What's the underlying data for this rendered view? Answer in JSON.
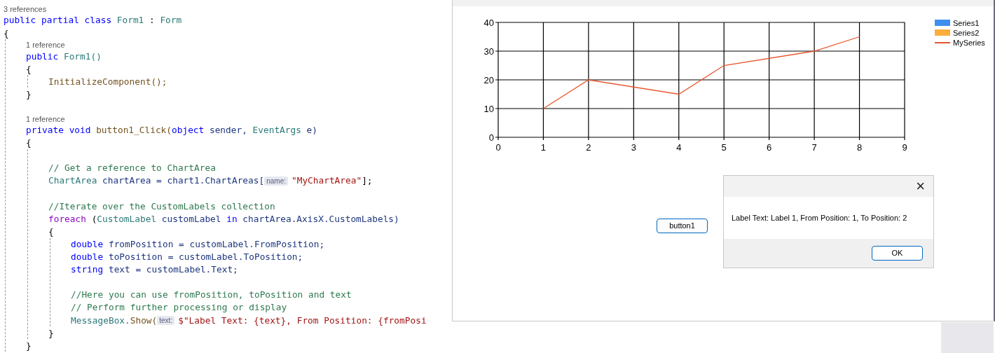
{
  "code": [
    {
      "kind": "lens",
      "text": "3 references"
    },
    {
      "kind": "line",
      "tokens": [
        {
          "kind": "keyword",
          "text": "public partial class"
        },
        {
          "kind": "type",
          "text": "Form1"
        },
        {
          "kind": "plain",
          "text": ":"
        },
        {
          "kind": "type",
          "text": "Form"
        }
      ]
    },
    {
      "kind": "line",
      "tokens": [
        {
          "kind": "plain",
          "text": "{"
        }
      ]
    },
    {
      "kind": "block",
      "children": [
        {
          "kind": "lens",
          "text": "1 reference"
        },
        {
          "kind": "line",
          "tokens": [
            {
              "kind": "keyword",
              "text": "public"
            },
            {
              "kind": "type",
              "text": "Form1()"
            }
          ]
        },
        {
          "kind": "line",
          "tokens": [
            {
              "kind": "plain",
              "text": "{"
            }
          ]
        },
        {
          "kind": "block",
          "children": [
            {
              "kind": "line",
              "tokens": [
                {
                  "kind": "method",
                  "text": "InitializeComponent();"
                }
              ]
            }
          ]
        },
        {
          "kind": "line",
          "tokens": [
            {
              "kind": "plain",
              "text": "}"
            }
          ]
        },
        {
          "kind": "blank"
        },
        {
          "kind": "lens",
          "text": "1 reference"
        },
        {
          "kind": "line",
          "tokens": [
            {
              "kind": "keyword",
              "text": "private void"
            },
            {
              "kind": "method",
              "text": "button1_Click("
            },
            {
              "kind": "keyword",
              "text": "object",
              "attached": true
            },
            {
              "kind": "param",
              "text": "sender,"
            },
            {
              "kind": "type",
              "text": "EventArgs"
            },
            {
              "kind": "param",
              "text": "e)"
            }
          ]
        },
        {
          "kind": "line",
          "tokens": [
            {
              "kind": "plain",
              "text": "{"
            }
          ]
        },
        {
          "kind": "block",
          "children": [
            {
              "kind": "blank"
            },
            {
              "kind": "line",
              "tokens": [
                {
                  "kind": "comment",
                  "text": "// Get a reference to ChartArea"
                }
              ]
            },
            {
              "kind": "line",
              "tokens": [
                {
                  "kind": "type",
                  "text": "ChartArea"
                },
                {
                  "kind": "param",
                  "text": "chartArea = chart1.ChartAreas["
                },
                {
                  "kind": "hint",
                  "text": "name:"
                },
                {
                  "kind": "string",
                  "text": "\"MyChartArea\""
                },
                {
                  "kind": "plain",
                  "text": "];",
                  "attached": true
                }
              ]
            },
            {
              "kind": "blank"
            },
            {
              "kind": "line",
              "tokens": [
                {
                  "kind": "comment",
                  "text": "//Iterate over the CustomLabels collection"
                }
              ]
            },
            {
              "kind": "line",
              "tokens": [
                {
                  "kind": "control",
                  "text": "foreach"
                },
                {
                  "kind": "plain",
                  "text": "("
                },
                {
                  "kind": "type",
                  "text": "CustomLabel",
                  "attached": true
                },
                {
                  "kind": "param",
                  "text": "customLabel"
                },
                {
                  "kind": "keyword",
                  "text": "in"
                },
                {
                  "kind": "param",
                  "text": "chartArea.AxisX.CustomLabels)"
                }
              ]
            },
            {
              "kind": "line",
              "tokens": [
                {
                  "kind": "plain",
                  "text": "{"
                }
              ]
            },
            {
              "kind": "block",
              "children": [
                {
                  "kind": "line",
                  "tokens": [
                    {
                      "kind": "keyword",
                      "text": "double"
                    },
                    {
                      "kind": "param",
                      "text": "fromPosition = customLabel.FromPosition;"
                    }
                  ]
                },
                {
                  "kind": "line",
                  "tokens": [
                    {
                      "kind": "keyword",
                      "text": "double"
                    },
                    {
                      "kind": "param",
                      "text": "toPosition = customLabel.ToPosition;"
                    }
                  ]
                },
                {
                  "kind": "line",
                  "tokens": [
                    {
                      "kind": "keyword",
                      "text": "string"
                    },
                    {
                      "kind": "param",
                      "text": "text = customLabel.Text;"
                    }
                  ]
                },
                {
                  "kind": "blank"
                },
                {
                  "kind": "line",
                  "tokens": [
                    {
                      "kind": "comment",
                      "text": "//Here you can use fromPosition, toPosition and text"
                    }
                  ]
                },
                {
                  "kind": "line",
                  "tokens": [
                    {
                      "kind": "comment",
                      "text": "// Perform further processing or display"
                    }
                  ]
                },
                {
                  "kind": "line",
                  "tokens": [
                    {
                      "kind": "type",
                      "text": "MessageBox"
                    },
                    {
                      "kind": "method",
                      "text": ".Show(",
                      "attached": true
                    },
                    {
                      "kind": "hint",
                      "text": "text:"
                    },
                    {
                      "kind": "string",
                      "text": "$\"Label Text: {text}, From Position: {fromPosi"
                    }
                  ]
                }
              ]
            },
            {
              "kind": "line",
              "tokens": [
                {
                  "kind": "plain",
                  "text": "}"
                }
              ]
            }
          ]
        },
        {
          "kind": "line",
          "tokens": [
            {
              "kind": "plain",
              "text": "}"
            }
          ]
        }
      ]
    }
  ],
  "form": {
    "chart_data": {
      "type": "line",
      "x": [
        1,
        2,
        4,
        5,
        7,
        8
      ],
      "xlim": [
        0,
        9
      ],
      "ylim": [
        0,
        40
      ],
      "xticks": [
        0,
        1,
        2,
        3,
        4,
        5,
        6,
        7,
        8,
        9
      ],
      "yticks": [
        0,
        10,
        20,
        30,
        40
      ],
      "grid": true,
      "series": [
        {
          "name": "Series1",
          "color": "#3f8ff0",
          "values": [
            null,
            null,
            null,
            null,
            null,
            null
          ]
        },
        {
          "name": "Series2",
          "color": "#fbae3c",
          "values": [
            null,
            null,
            null,
            null,
            null,
            null
          ]
        },
        {
          "name": "MySeries",
          "color": "#e8552a",
          "values": [
            10,
            20,
            15,
            25,
            30,
            35
          ]
        }
      ]
    },
    "button": "button1",
    "dialog": {
      "close": "×",
      "message": "Label Text: Label 1, From Position: 1, To Position: 2",
      "ok": "OK"
    }
  }
}
